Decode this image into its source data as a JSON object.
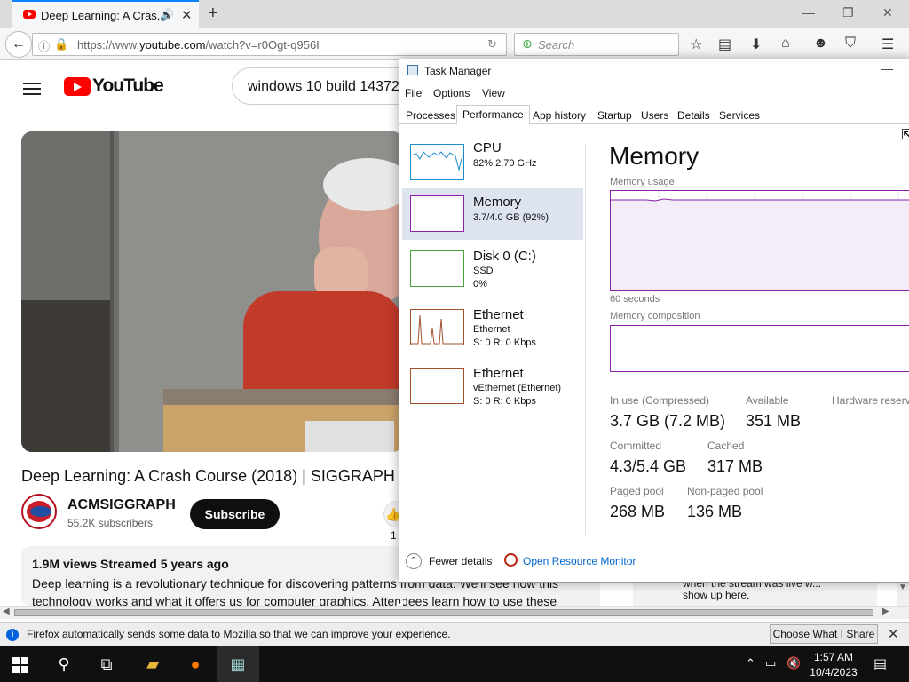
{
  "browser": {
    "tab_title": "Deep Learning: A Cras...",
    "new_tab": "+",
    "url_prefix": "https://www.",
    "url_domain": "youtube.com",
    "url_suffix": "/watch?v=r0Ogt-q956I",
    "search_placeholder": "Search",
    "window_controls": [
      "—",
      "❐",
      "✕"
    ]
  },
  "youtube": {
    "logo_text": "YouTube",
    "search_query": "windows 10 build 14372",
    "video_title": "Deep Learning: A Crash Course (2018) | SIGGRAPH",
    "channel_name": "ACMSIGGRAPH",
    "subscribers": "55.2K subscribers",
    "subscribe_label": "Subscribe",
    "like_count": "1",
    "views_meta": "1.9M views  Streamed 5 years ago",
    "description": "Deep learning is a revolutionary technique for discovering patterns from data. We'll see how this technology works and what it offers us for computer graphics. Attendees learn how to use these",
    "live_text": "show up here.",
    "live_text_top": "when the stream was live w..."
  },
  "notification": {
    "message": "Firefox automatically sends some data to Mozilla so that we can improve your experience.",
    "button": "Choose What I Share"
  },
  "taskbar": {
    "time": "1:57 AM",
    "date": "10/4/2023"
  },
  "task_manager": {
    "title": "Task Manager",
    "menu": [
      "File",
      "Options",
      "View"
    ],
    "tabs": [
      "Processes",
      "Performance",
      "App history",
      "Startup",
      "Users",
      "Details",
      "Services"
    ],
    "active_tab": "Performance",
    "sidebar": [
      {
        "name": "CPU",
        "line1": "82%  2.70 GHz",
        "line2": ""
      },
      {
        "name": "Memory",
        "line1": "3.7/4.0 GB (92%)",
        "line2": ""
      },
      {
        "name": "Disk 0 (C:)",
        "line1": "SSD",
        "line2": "0%"
      },
      {
        "name": "Ethernet",
        "line1": "Ethernet",
        "line2": "S: 0  R: 0 Kbps"
      },
      {
        "name": "Ethernet",
        "line1": "vEthernet (Ethernet)",
        "line2": "S: 0  R: 0 Kbps"
      }
    ],
    "heading": "Memory",
    "usage_label": "Memory usage",
    "time_label": "60 seconds",
    "composition_label": "Memory composition",
    "stats": {
      "in_use_label": "In use (Compressed)",
      "in_use": "3.7 GB (7.2 MB)",
      "available_label": "Available",
      "available": "351 MB",
      "hw_label": "Hardware reserve",
      "committed_label": "Committed",
      "committed": "4.3/5.4 GB",
      "cached_label": "Cached",
      "cached": "317 MB",
      "paged_label": "Paged pool",
      "paged": "268 MB",
      "nonpaged_label": "Non-paged pool",
      "nonpaged": "136 MB"
    },
    "fewer_details": "Fewer details",
    "resource_monitor": "Open Resource Monitor",
    "accent": "#8b22a8"
  }
}
